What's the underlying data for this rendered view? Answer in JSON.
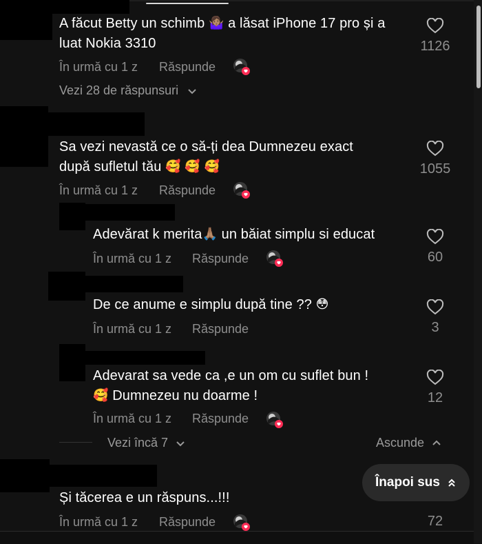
{
  "comments": [
    {
      "text_line1": "A făcut Betty un schimb",
      "text_line1_after": "a lăsat iPhone 17 pro și a",
      "text_line2": "luat Nokia 3310",
      "time": "În urmă cu 1 z",
      "reply": "Răspunde",
      "likes": "1126",
      "view_replies": "Vezi 28 de răspunsuri"
    },
    {
      "text_line1": "Sa vezi nevastă ce o să-ți dea Dumnezeu exact",
      "text_line2": "după sufletul tău",
      "time": "În urmă cu 1 z",
      "reply": "Răspunde",
      "likes": "1055",
      "replies": [
        {
          "text_before": "Adevărat k merita",
          "text_after": "un băiat simplu si educat",
          "time": "În urmă cu 1 z",
          "reply": "Răspunde",
          "likes": "60"
        },
        {
          "text": "De ce anume e simplu după tine ??",
          "time": "În urmă cu 1 z",
          "reply": "Răspunde",
          "likes": "3"
        },
        {
          "text_line1": "Adevarat sa vede ca ,e un om cu suflet bun !",
          "text_line2": "Dumnezeu nu doarme !",
          "time": "În urmă cu 1 z",
          "reply": "Răspunde",
          "likes": "12"
        }
      ],
      "view_more": "Vezi încă 7",
      "hide": "Ascunde"
    },
    {
      "text": "Și tăcerea e un răspuns...!!!",
      "time": "În urmă cu 1 z",
      "reply": "Răspunde",
      "likes": "72"
    }
  ],
  "back_to_top": "Înapoi sus",
  "icons": {
    "like": "heart-outline-icon",
    "creator_liked": "creator-liked-avatar-icon",
    "chevron_down": "chevron-down-icon",
    "chevron_up": "chevron-up-icon",
    "double_chevron_up": "double-chevron-up-icon"
  },
  "colors": {
    "background": "#121212",
    "text": "#ffffff",
    "muted": "#8e8e8e",
    "like_badge": "#fe2c55"
  }
}
